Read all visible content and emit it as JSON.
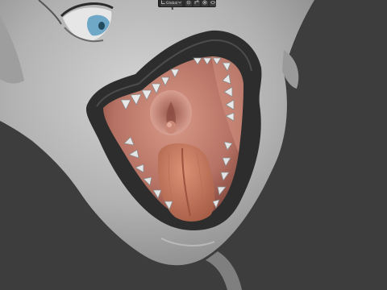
{
  "header": {
    "transform_orientation": {
      "icon": "orientation-icon",
      "label": "Global",
      "dropdown_icon": "chevron-down-icon"
    },
    "pivot_icon": "pivot-point-icon",
    "snap_icon": "snap-icon",
    "proportional_icon": "proportional-editing-icon",
    "overlay_icon": "overlay-icon"
  },
  "colors": {
    "viewport_bg": "#3d3d3d",
    "skin": "#b9b9b9",
    "lips": "#2a2a2a",
    "mouth_inner": "#c4877a",
    "tongue": "#c97a62",
    "eye_iris": "#69a9c9"
  }
}
